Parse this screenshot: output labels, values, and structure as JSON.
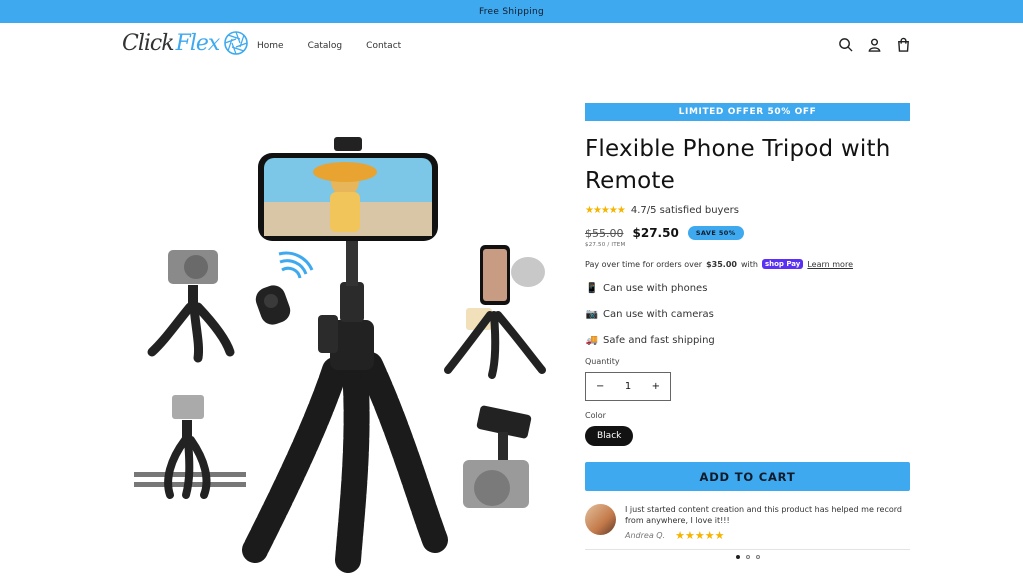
{
  "announcement": "Free Shipping",
  "brand": {
    "part1": "Click",
    "part2": "Flex"
  },
  "nav": {
    "home": "Home",
    "catalog": "Catalog",
    "contact": "Contact"
  },
  "header_icons": [
    "search-icon",
    "account-icon",
    "cart-icon"
  ],
  "product": {
    "offer_badge": "LIMITED OFFER 50% OFF",
    "title": "Flexible Phone Tripod with Remote",
    "rating_stars": "★★★★★",
    "rating_text": "4.7/5 satisfied buyers",
    "price_old": "$55.00",
    "price_new": "$27.50",
    "save_badge": "SAVE 50%",
    "unit_price": "$27.50 / ITEM",
    "pay_text_before": "Pay over time for orders over",
    "pay_threshold": "$35.00",
    "pay_text_with": "with",
    "shop_pay": "shop Pay",
    "learn_more": "Learn more",
    "features": [
      {
        "icon": "📱",
        "text": "Can use with phones"
      },
      {
        "icon": "📷",
        "text": "Can use with cameras"
      },
      {
        "icon": "🚚",
        "text": "Safe and fast shipping"
      }
    ],
    "quantity_label": "Quantity",
    "quantity_value": "1",
    "color_label": "Color",
    "color_value": "Black",
    "add_to_cart": "ADD TO CART"
  },
  "review": {
    "text": "I just started content creation and this product has helped me record from anywhere, I love it!!!",
    "author": "Andrea Q.",
    "stars": "★★★★★"
  },
  "colors": {
    "accent": "#3fa9ef",
    "dark": "#121212",
    "star": "#f5b400"
  }
}
